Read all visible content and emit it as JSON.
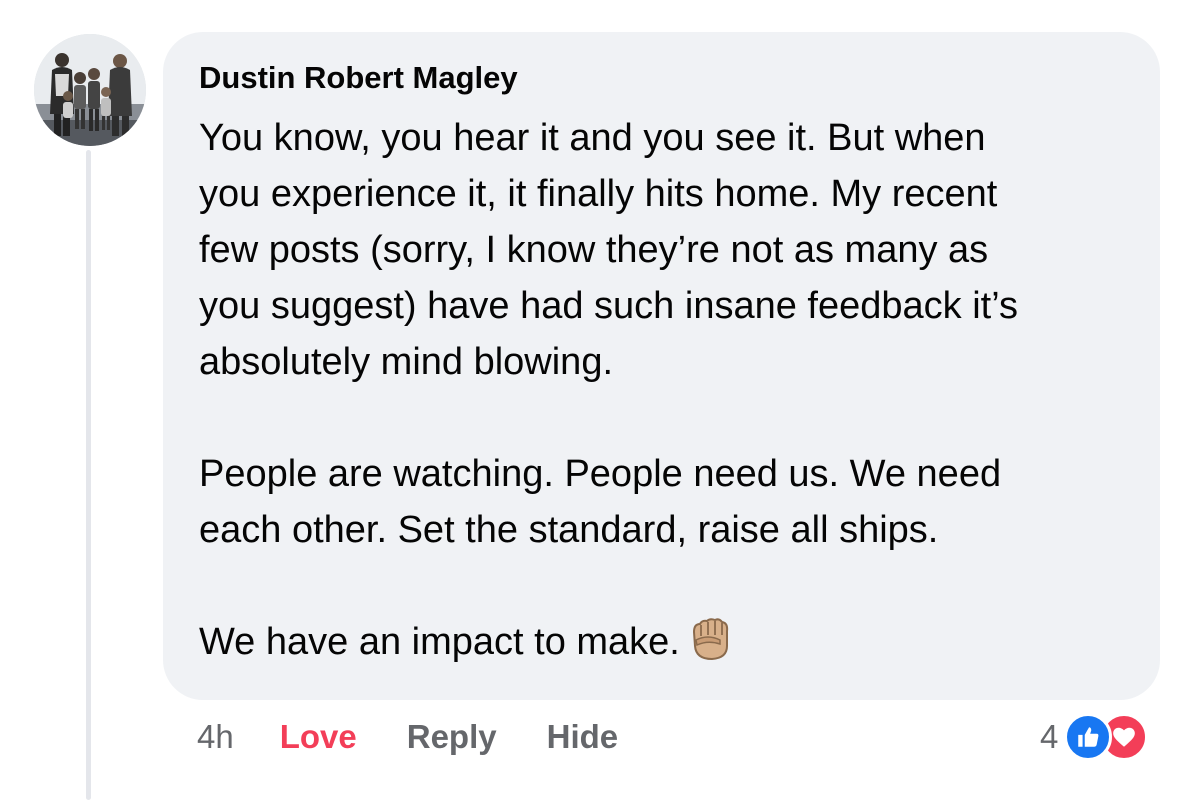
{
  "comment": {
    "author": "Dustin Robert Magley",
    "paragraphs": [
      {
        "lines": [
          "You know, you hear it and you see it. But when",
          "you experience it, it finally hits home. My recent",
          "few posts (sorry, I know they’re not as many as",
          "you suggest) have had such insane feedback it’s",
          "absolutely mind blowing."
        ]
      },
      {
        "lines": [
          "People are watching. People need us. We need",
          "each other. Set the standard, raise all ships."
        ]
      },
      {
        "lines": [
          "We have an impact to make."
        ],
        "emoji": "raised-fist-icon"
      }
    ]
  },
  "actions": {
    "time": "4h",
    "love_label": "Love",
    "reply_label": "Reply",
    "hide_label": "Hide"
  },
  "reactions": {
    "count": "4",
    "icons": [
      "like-icon",
      "heart-icon"
    ]
  },
  "colors": {
    "bubble": "#f0f2f5",
    "love": "#f33e58",
    "like": "#1877f2",
    "muted": "#65676b"
  }
}
